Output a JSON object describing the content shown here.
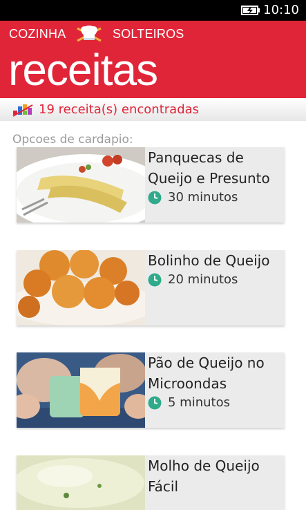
{
  "status_bar": {
    "time": "10:10"
  },
  "header": {
    "brand_left": "COZINHA",
    "brand_right": "SOLTEIROS",
    "title": "receitas"
  },
  "results": {
    "count_text": "19 receita(s) encontradas"
  },
  "section_label": "Opcoes de cardapio:",
  "recipes": [
    {
      "title": "Panquecas de Queijo e Presunto",
      "time": "30 minutos",
      "image": "crepes-photo"
    },
    {
      "title": "Bolinho de Queijo",
      "time": "20 minutos",
      "image": "cheese-balls-photo"
    },
    {
      "title": "Pão de Queijo no Microondas",
      "time": "5 minutos",
      "image": "mugs-photo"
    },
    {
      "title": "Molho de Queijo Fácil",
      "time": "",
      "image": "cheese-sauce-photo"
    }
  ],
  "colors": {
    "accent": "#e12539",
    "card_bg": "#ebebeb",
    "clock": "#2faa8a"
  }
}
